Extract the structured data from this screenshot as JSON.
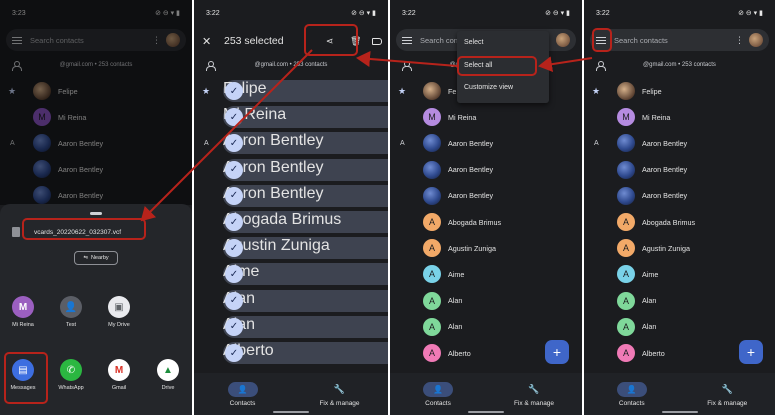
{
  "panel1": {
    "status_time": "3:23",
    "search_placeholder": "Search contacts",
    "account_text": "@gmail.com • 253 contacts",
    "contacts": [
      {
        "name": "Felipe",
        "side": "star"
      },
      {
        "name": "Mi Reina",
        "initial": "M",
        "side": ""
      },
      {
        "name": "Aaron Bentley",
        "side": "A"
      },
      {
        "name": "Aaron Bentley",
        "side": ""
      },
      {
        "name": "Aaron Bentley",
        "side": ""
      }
    ],
    "file_name": "vcards_20220622_032307.vcf",
    "nearby_label": "Nearby",
    "share_row1": [
      {
        "label": "Mi Reina",
        "icon": "M",
        "color": "#9b5fc0"
      },
      {
        "label": "Test",
        "icon": "person-icon",
        "color": "#5b5e66"
      },
      {
        "label": "My Drive",
        "icon": "drive-folder-icon",
        "color": "#e9eaee"
      }
    ],
    "share_row2": [
      {
        "label": "Messages",
        "icon": "messages-icon",
        "color": "#3d6ee0"
      },
      {
        "label": "WhatsApp",
        "icon": "whatsapp-icon",
        "color": "#2bb741"
      },
      {
        "label": "Gmail",
        "icon": "gmail-icon",
        "color": "#ffffff"
      },
      {
        "label": "Drive",
        "icon": "drive-icon",
        "color": "#ffffff"
      }
    ]
  },
  "panel2": {
    "status_time": "3:22",
    "title": "253 selected",
    "account_text": "@gmail.com • 253 contacts",
    "contacts": [
      "Felipe",
      "Mi Reina",
      "Aaron Bentley",
      "Aaron Bentley",
      "Aaron Bentley",
      "Abogada Brimus",
      "Agustin Zuniga",
      "Aime",
      "Alan",
      "Alan",
      "Alberto"
    ],
    "nav": {
      "contacts": "Contacts",
      "fix": "Fix & manage"
    }
  },
  "panel3": {
    "status_time": "3:22",
    "search_placeholder": "Search conta",
    "menu": [
      "Select",
      "Select all",
      "Customize view"
    ],
    "account_text": "@gmail.com • 253 contacts",
    "contacts": [
      {
        "name": "Fe",
        "initial": "",
        "color": "felipe"
      },
      {
        "name": "Mi Reina",
        "initial": "M",
        "color": "#b58be0"
      },
      {
        "name": "Aaron Bentley",
        "initial": "",
        "color": "photo"
      },
      {
        "name": "Aaron Bentley",
        "initial": "",
        "color": "photo"
      },
      {
        "name": "Aaron Bentley",
        "initial": "",
        "color": "photo"
      },
      {
        "name": "Abogada Brimus",
        "initial": "A",
        "color": "#f2a968"
      },
      {
        "name": "Agustin Zuniga",
        "initial": "A",
        "color": "#f2a968"
      },
      {
        "name": "Aime",
        "initial": "A",
        "color": "#79d2e8"
      },
      {
        "name": "Alan",
        "initial": "A",
        "color": "#7fd89a"
      },
      {
        "name": "Alan",
        "initial": "A",
        "color": "#7fd89a"
      },
      {
        "name": "Alberto",
        "initial": "A",
        "color": "#f07ab6"
      }
    ],
    "fab": "+",
    "nav": {
      "contacts": "Contacts",
      "fix": "Fix & manage"
    }
  },
  "panel4": {
    "status_time": "3:22",
    "search_placeholder": "Search contacts",
    "account_text": "@gmail.com • 253 contacts",
    "contacts": [
      {
        "name": "Felipe",
        "initial": "",
        "color": "felipe"
      },
      {
        "name": "Mi Reina",
        "initial": "M",
        "color": "#b58be0"
      },
      {
        "name": "Aaron Bentley",
        "initial": "",
        "color": "photo"
      },
      {
        "name": "Aaron Bentley",
        "initial": "",
        "color": "photo"
      },
      {
        "name": "Aaron Bentley",
        "initial": "",
        "color": "photo"
      },
      {
        "name": "Abogada Brimus",
        "initial": "A",
        "color": "#f2a968"
      },
      {
        "name": "Agustin Zuniga",
        "initial": "A",
        "color": "#f2a968"
      },
      {
        "name": "Aime",
        "initial": "A",
        "color": "#79d2e8"
      },
      {
        "name": "Alan",
        "initial": "A",
        "color": "#7fd89a"
      },
      {
        "name": "Alan",
        "initial": "A",
        "color": "#7fd89a"
      },
      {
        "name": "Alberto",
        "initial": "A",
        "color": "#f07ab6"
      }
    ],
    "fab": "+",
    "nav": {
      "contacts": "Contacts",
      "fix": "Fix & manage"
    }
  },
  "colors": {
    "annotation_red": "#b7231b",
    "accent": "#c5d3f7"
  }
}
